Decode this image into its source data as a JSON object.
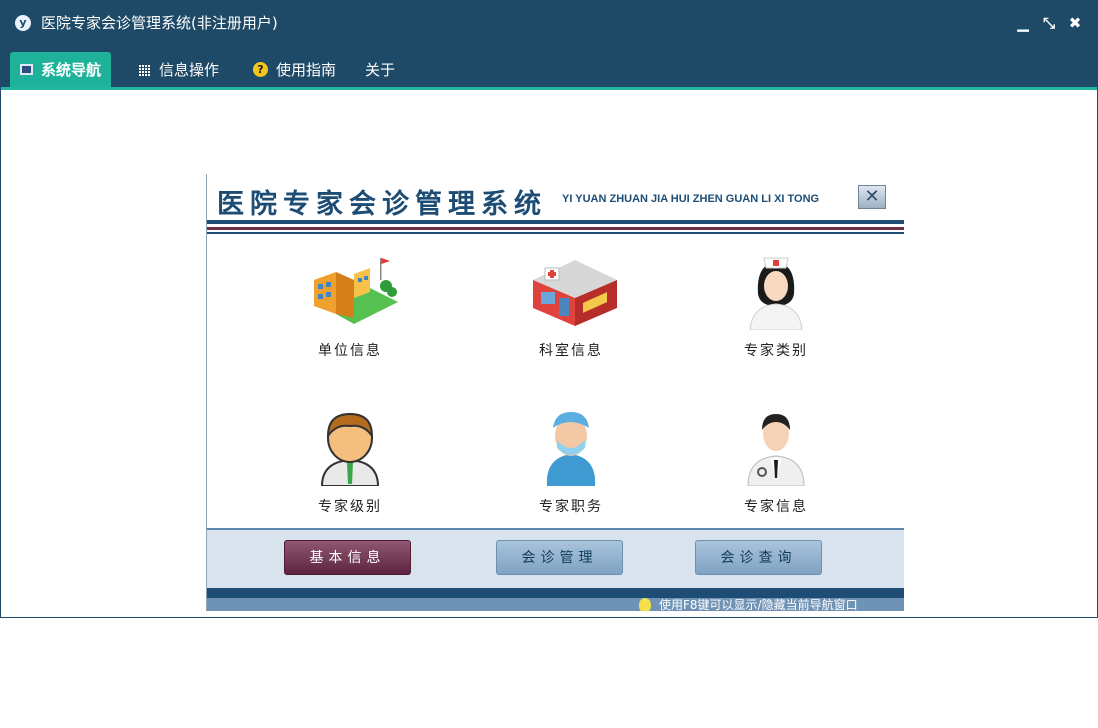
{
  "window": {
    "title": "医院专家会诊管理系统(非注册用户)",
    "controls": {
      "minimize": "▁",
      "restore": "⤡",
      "close": "✖"
    }
  },
  "menu": {
    "items": [
      {
        "label": "系统导航",
        "icon": "monitor-icon",
        "active": true
      },
      {
        "label": "信息操作",
        "icon": "grid-icon",
        "active": false
      },
      {
        "label": "使用指南",
        "icon": "help-icon",
        "active": false
      },
      {
        "label": "关于",
        "icon": "",
        "active": false
      }
    ]
  },
  "panel": {
    "title": "医院专家会诊管理系统",
    "subtitle": "YI YUAN ZHUAN JIA HUI ZHEN GUAN LI XI TONG",
    "close_glyph": "✕",
    "tiles": [
      {
        "label": "单位信息",
        "icon": "building-icon"
      },
      {
        "label": "科室信息",
        "icon": "clinic-icon"
      },
      {
        "label": "专家类别",
        "icon": "nurse-icon"
      },
      {
        "label": "专家级别",
        "icon": "person-icon"
      },
      {
        "label": "专家职务",
        "icon": "surgeon-icon"
      },
      {
        "label": "专家信息",
        "icon": "doctor-icon"
      }
    ],
    "footer_buttons": [
      {
        "label": "基本信息",
        "active": true
      },
      {
        "label": "会诊管理",
        "active": false
      },
      {
        "label": "会诊查询",
        "active": false
      }
    ],
    "hint": "使用F8键可以显示/隐藏当前导航窗口"
  },
  "colors": {
    "titlebar": "#1f4a67",
    "active_tab": "#1fb29b",
    "panel_title": "#1d4d74",
    "active_button": "#6d2f46"
  }
}
